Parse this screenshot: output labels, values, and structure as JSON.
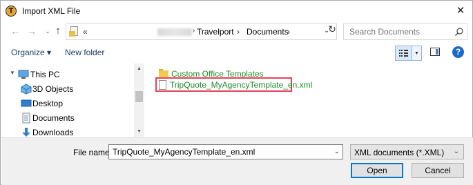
{
  "window": {
    "title": "Import XML File",
    "app_icon_letter": "T"
  },
  "navigation": {
    "address": {
      "overflow": "«",
      "segments": [
        "Travelport",
        "Documents"
      ]
    },
    "search": {
      "placeholder": "Search Documents"
    }
  },
  "toolbar": {
    "organize_label": "Organize ▾",
    "new_folder_label": "New folder",
    "help_label": "?"
  },
  "nav_pane": {
    "items": [
      {
        "label": "This PC",
        "icon": "pc-icon"
      },
      {
        "label": "3D Objects",
        "icon": "3d-objects-icon"
      },
      {
        "label": "Desktop",
        "icon": "desktop-icon"
      },
      {
        "label": "Documents",
        "icon": "documents-icon"
      },
      {
        "label": "Downloads",
        "icon": "downloads-icon"
      }
    ]
  },
  "files": [
    {
      "name": "Custom Office Templates",
      "type": "folder",
      "selected": false
    },
    {
      "name": "TripQuote_MyAgencyTemplate_en.xml",
      "type": "xml",
      "selected": true
    }
  ],
  "bottom": {
    "file_name_label": "File name:",
    "file_name_value": "TripQuote_MyAgencyTemplate_en.xml",
    "file_type": "XML documents (*.XML)",
    "open_label": "Open",
    "cancel_label": "Cancel"
  },
  "colors": {
    "file_text": "#1e8a26",
    "selection_border": "#e8405a",
    "primary_border": "#0078d7"
  }
}
